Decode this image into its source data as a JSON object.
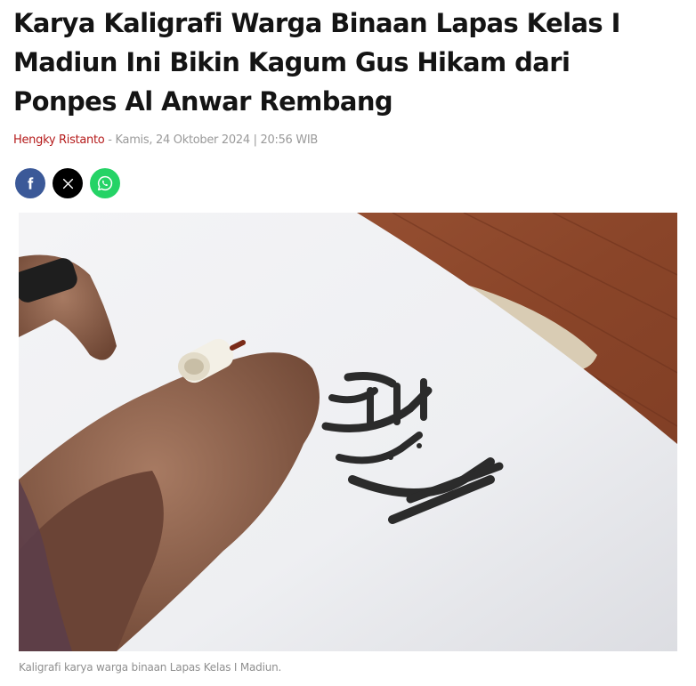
{
  "article": {
    "title": "Karya Kaligrafi Warga Binaan Lapas Kelas I Madiun Ini Bikin Kagum Gus Hikam dari Ponpes Al Anwar Rembang",
    "author": "Hengky Ristanto",
    "separator": "-",
    "date": "Kamis, 24 Oktober 2024 | 20:56 WIB"
  },
  "share": {
    "facebook_icon": "facebook-icon",
    "x_icon": "x-icon",
    "whatsapp_icon": "whatsapp-icon"
  },
  "photo": {
    "caption": "Kaligrafi karya warga binaan Lapas Kelas I Madiun."
  },
  "colors": {
    "author": "#b51b1b",
    "facebook": "#3b5998",
    "x": "#000000",
    "whatsapp": "#25d366"
  }
}
